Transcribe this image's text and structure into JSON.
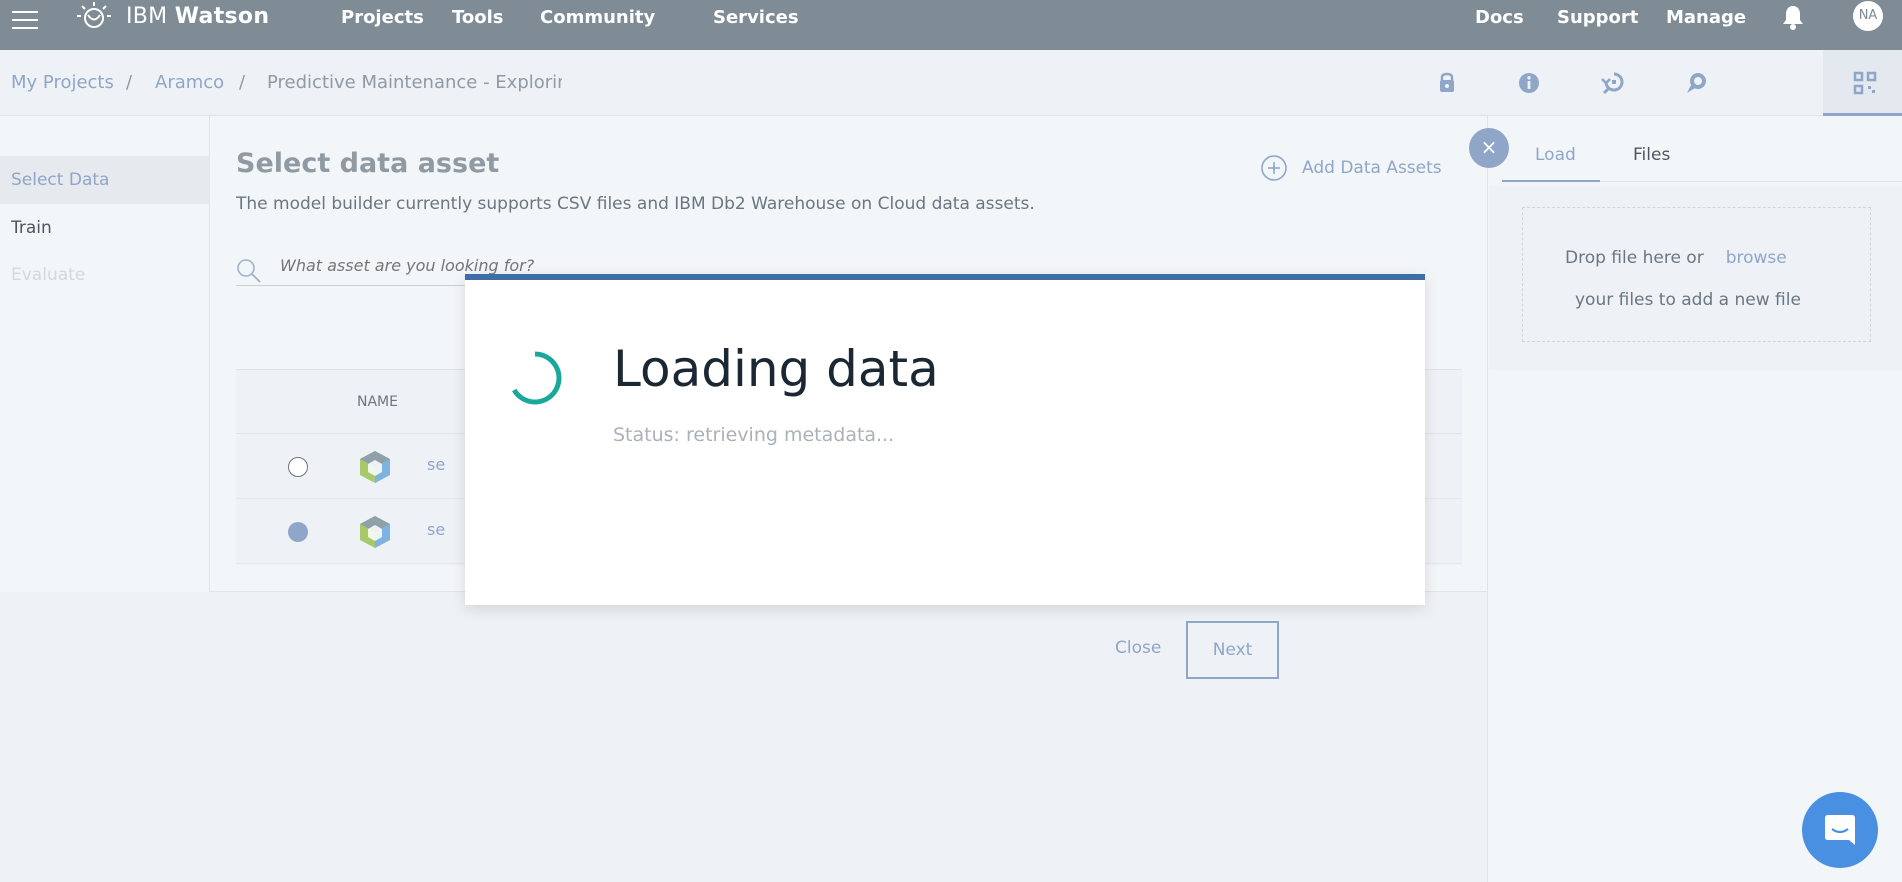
{
  "topbar": {
    "brand_prefix": "IBM",
    "brand_name": "Watson",
    "nav": [
      "Projects",
      "Tools",
      "Community",
      "Services"
    ],
    "right_nav": [
      "Docs",
      "Support",
      "Manage"
    ],
    "avatar_initials": "NA"
  },
  "breadcrumb": {
    "items": [
      "My Projects",
      "Aramco"
    ],
    "separator": "/",
    "current": "Predictive Maintenance - Exploring S"
  },
  "toolstrip": {
    "icons": [
      "info-icon",
      "find-replace-icon",
      "chat-bubble-icon",
      "data-assets-icon",
      "compass-icon"
    ],
    "active_index": 3
  },
  "leftnav": {
    "items": [
      "Select Data",
      "Train",
      "Evaluate"
    ],
    "active": "Select Data"
  },
  "main": {
    "title": "Select data asset",
    "description": "The model builder currently supports CSV files and IBM Db2 Warehouse on Cloud data assets.",
    "add_assets_label": "Add Data Assets",
    "search_placeholder": "What asset are you looking for?",
    "table": {
      "columns": [
        "NAME"
      ],
      "rows": [
        {
          "name": "se",
          "selected": false
        },
        {
          "name": "se",
          "selected": true
        }
      ]
    },
    "close_label": "Close",
    "next_label": "Next"
  },
  "sidepanel": {
    "close_glyph": "×",
    "tabs": [
      "Load",
      "Files"
    ],
    "active_tab": "Load",
    "drop_text": "Drop file here or",
    "browse_label": "browse",
    "drop_text_2": "your files to add a new file"
  },
  "modal": {
    "title": "Loading data",
    "status": "Status: retrieving metadata..."
  },
  "colors": {
    "topbar": "#7f8c95",
    "accent": "#8fa6c8",
    "modal_bar": "#3f6ea5",
    "spinner": "#1aa89a",
    "chat": "#4a90e2"
  }
}
